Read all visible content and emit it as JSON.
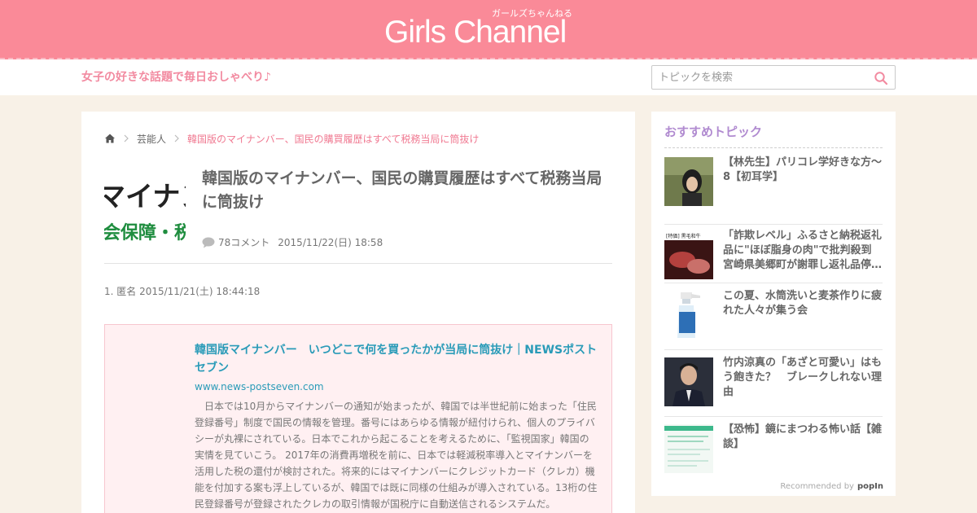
{
  "header": {
    "logo": "Girls Channel",
    "logo_sub": "ガールズちゃんねる",
    "tagline": "女子の好きな話題で毎日おしゃべり♪",
    "search_placeholder": "トピックを検索",
    "icons": [
      "search-icon"
    ]
  },
  "breadcrumb": {
    "category": "芸能人",
    "current": "韓国版のマイナンバー、国民の購買履歴はすべて税務当局に筒抜け"
  },
  "topic": {
    "thumb_text_top": "マイナン",
    "thumb_text_bottom": "会保障・税",
    "title": "韓国版のマイナンバー、国民の購買履歴はすべて税務当局に筒抜け",
    "comments": "78コメント",
    "date": "2015/11/22(日) 18:58"
  },
  "first_comment": {
    "header": "1. 匿名 2015/11/21(土) 18:44:18",
    "link_title": "韓国版マイナンバー　いつどこで何を買ったかが当局に筒抜け｜NEWSポストセブン",
    "link_url": "www.news-postseven.com",
    "link_body": "日本では10月からマイナンバーの通知が始まったが、韓国では半世紀前に始まった「住民登録番号」制度で国民の情報を管理。番号にはあらゆる情報が紐付けられ、個人のプライバシーが丸裸にされている。日本でこれから起こることを考えるために、「監視国家」韓国の実情を見ていこう。 2017年の消費再増税を前に、日本では軽減税率導入とマイナンバーを活用した税の還付が検討された。将来的にはマイナンバーにクレジットカード（クレカ）機能を付加する案も浮上しているが、韓国では既に同様の仕組みが導入されている。13桁の住民登録番号が登録されたクレカの取引情報が国税庁に自動送信されるシステムだ。"
  },
  "sidebar": {
    "title": "おすすめトピック",
    "items": [
      {
        "text": "【林先生】パリコレ学好きな方～8【初耳学】"
      },
      {
        "text": "「詐欺レベル」ふるさと納税返礼品に\"ほぼ脂身の肉\"で批判殺到 宮崎県美郷町が謝罪し返礼品停…"
      },
      {
        "text": "この夏、水筒洗いと麦茶作りに疲れた人々が集う会"
      },
      {
        "text": "竹内涼真の「あざと可愛い」はもう飽きた？　ブレークしれない理由"
      },
      {
        "text": "【恐怖】鏡にまつわる怖い話【雑談】"
      }
    ],
    "thumb2_text": "[特価] 黒毛和牛",
    "recommended_by": "Recommended by",
    "recommended_brand": "popIn"
  },
  "colors": {
    "header_pink": "#fa8a98",
    "tagline_pink": "#f28aa0",
    "link_blue": "#2a9bb8",
    "side_title_purple": "#b08ad0",
    "page_bg": "#f8f1e7"
  }
}
